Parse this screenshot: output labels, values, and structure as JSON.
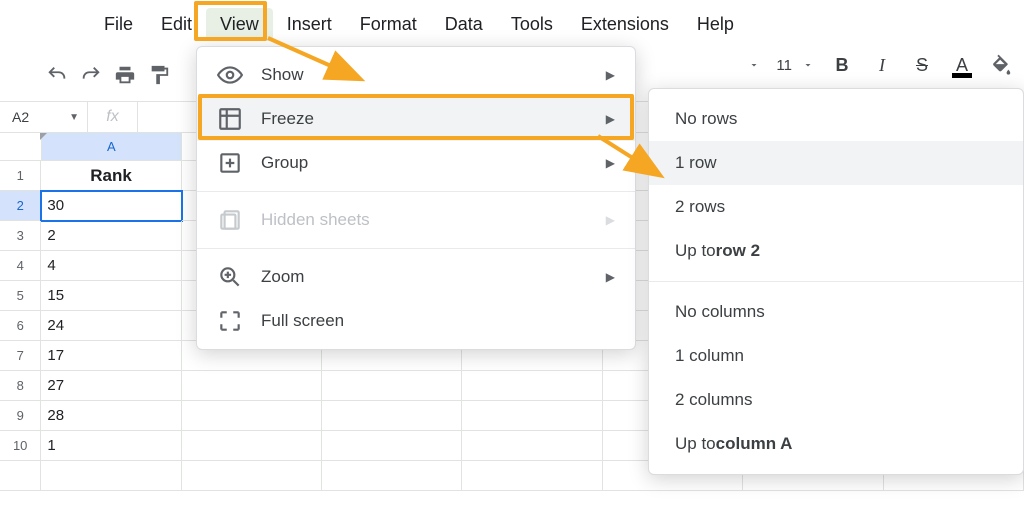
{
  "menubar": {
    "items": [
      "File",
      "Edit",
      "View",
      "Insert",
      "Format",
      "Data",
      "Tools",
      "Extensions",
      "Help"
    ],
    "active": "View"
  },
  "toolbar": {
    "font_size": "11"
  },
  "namebox": {
    "value": "A2",
    "fx_label": "fx"
  },
  "grid": {
    "col_label": "A",
    "header_cell": "Rank",
    "rows": [
      "30",
      "2",
      "4",
      "15",
      "24",
      "17",
      "27",
      "28",
      "1"
    ]
  },
  "view_menu": {
    "show": "Show",
    "freeze": "Freeze",
    "group": "Group",
    "hidden_sheets": "Hidden sheets",
    "zoom": "Zoom",
    "full_screen": "Full screen"
  },
  "freeze_submenu": {
    "no_rows": "No rows",
    "one_row": "1 row",
    "two_rows": "2 rows",
    "up_to_row_prefix": "Up to ",
    "up_to_row_bold": "row 2",
    "no_cols": "No columns",
    "one_col": "1 column",
    "two_cols": "2 columns",
    "up_to_col_prefix": "Up to ",
    "up_to_col_bold": "column A"
  }
}
